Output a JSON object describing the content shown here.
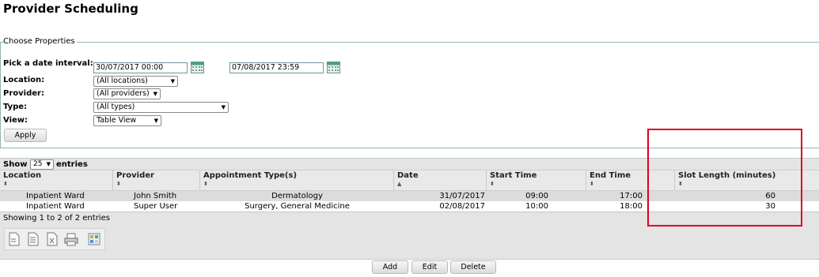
{
  "page": {
    "title": "Provider Scheduling"
  },
  "properties": {
    "legend": "Choose Properties",
    "date_interval_label": "Pick a date interval:",
    "start_date": "30/07/2017 00:00",
    "end_date": "07/08/2017 23:59",
    "location_label": "Location:",
    "location_value": "(All locations)",
    "provider_label": "Provider:",
    "provider_value": "(All providers)",
    "type_label": "Type:",
    "type_value": "(All types)",
    "view_label": "View:",
    "view_value": "Table View",
    "apply_label": "Apply"
  },
  "table": {
    "show_label": "Show",
    "page_size": "25",
    "entries_label": "entries",
    "columns": [
      "Location",
      "Provider",
      "Appointment Type(s)",
      "Date",
      "Start Time",
      "End Time",
      "Slot Length (minutes)"
    ],
    "rows": [
      [
        "Inpatient Ward",
        "John Smith",
        "Dermatology",
        "31/07/2017",
        "09:00",
        "17:00",
        "60"
      ],
      [
        "Inpatient Ward",
        "Super User",
        "Surgery, General Medicine",
        "02/08/2017",
        "10:00",
        "18:00",
        "30"
      ]
    ],
    "info": "Showing 1 to 2 of 2 entries"
  },
  "toolbar_icons": [
    "copy-icon",
    "csv-icon",
    "excel-icon",
    "print-icon",
    "column-visibility-icon"
  ],
  "actions": {
    "add_label": "Add",
    "edit_label": "Edit",
    "delete_label": "Delete"
  },
  "colors": {
    "highlight": "#e0001b",
    "fieldset_line": "#8fb7b4",
    "row_selected": "#dcdcdc"
  }
}
